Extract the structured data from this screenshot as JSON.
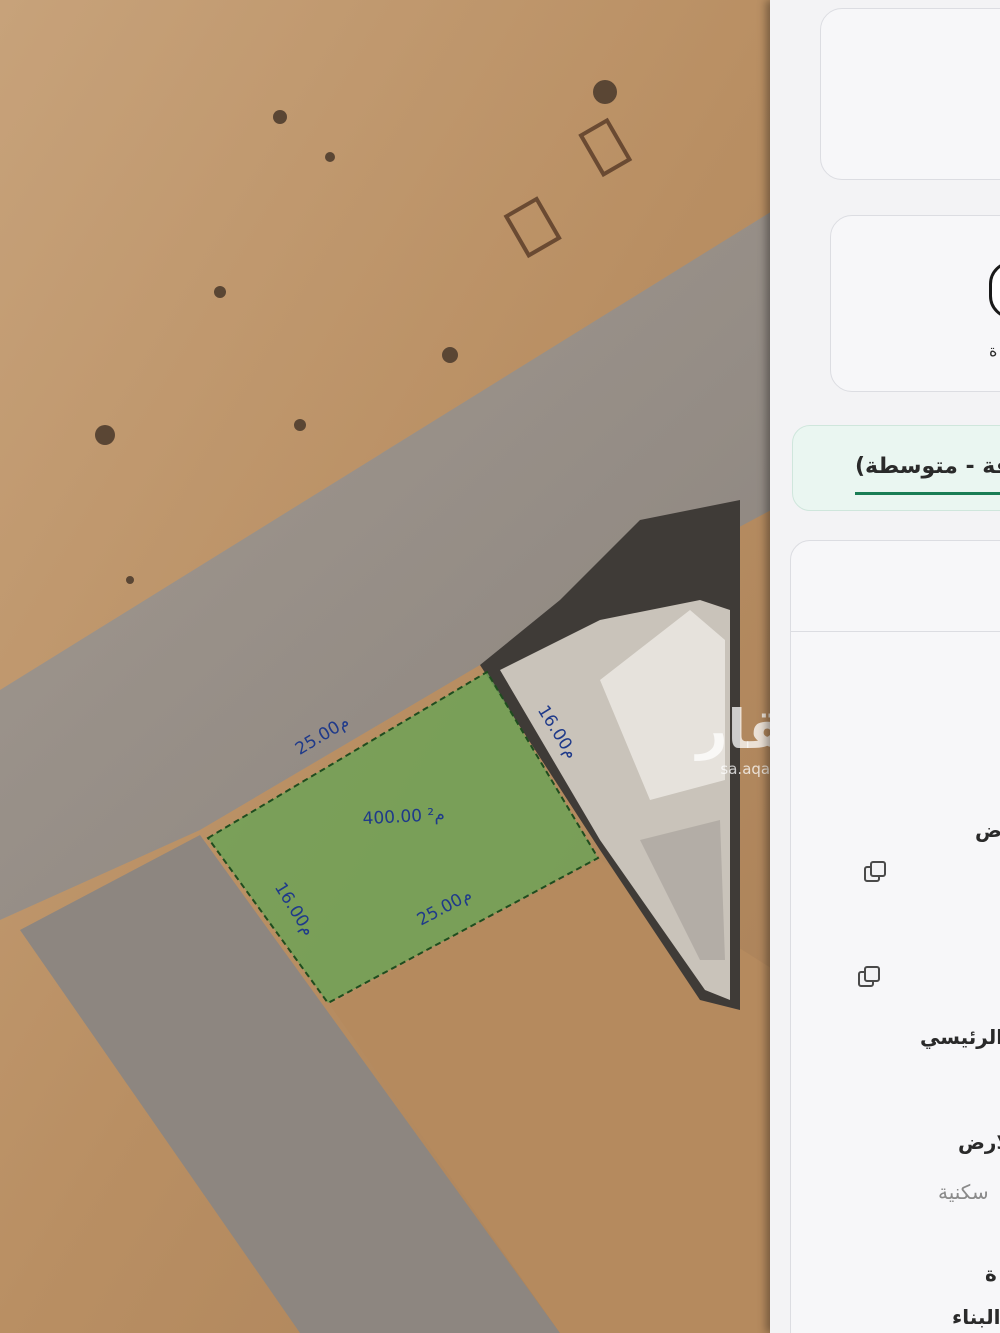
{
  "map": {
    "plot": {
      "area_label": "400.00 م²",
      "edge_top": "25.00م",
      "edge_bottom": "25.00م",
      "edge_left": "16.00م",
      "edge_right": "16.00م",
      "fill_color": "#6ea257",
      "outline_color": "#1f4d1f"
    },
    "watermark": {
      "logo": "عقار",
      "url": "sa.aqar.fm"
    }
  },
  "panel": {
    "category_field": "قة - متوسطة)",
    "labels": {
      "row_a": "ض",
      "row_b": "الرئيسي",
      "row_c": "لارض",
      "row_d": "سكنية",
      "row_e": "ة",
      "row_f": "ط البناء"
    },
    "fragment_top": "ة"
  },
  "colors": {
    "accent": "#1a7d55",
    "panel_bg": "#f3f3f5"
  }
}
